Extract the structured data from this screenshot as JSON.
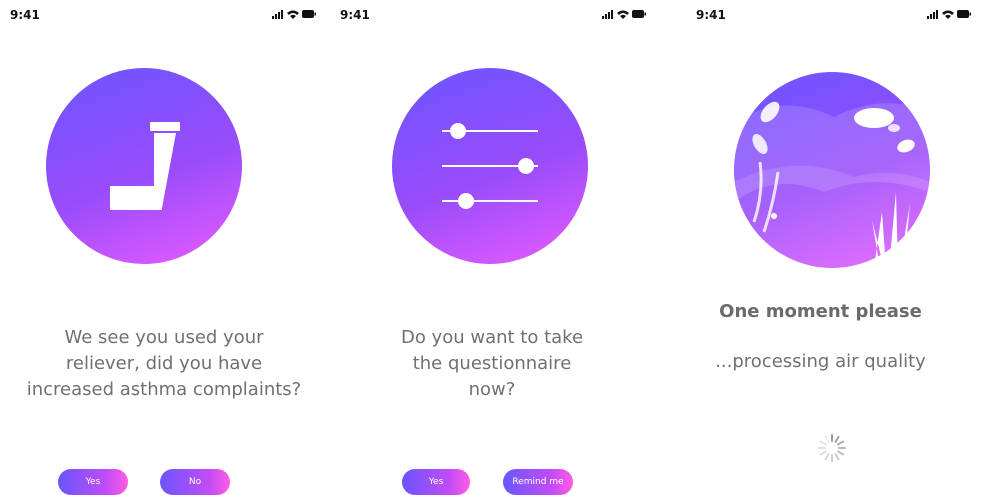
{
  "screens": [
    {
      "time": "9:41",
      "prompt": [
        "We see you used your",
        "reliever, did you have",
        "increased asthma complaints?"
      ],
      "buttons": [
        "Yes",
        "No"
      ]
    },
    {
      "time": "9:41",
      "prompt": [
        "Do you want to take",
        "the questionnaire",
        "now?"
      ],
      "buttons": [
        "Yes",
        "Remind me"
      ]
    },
    {
      "time": "9:41",
      "title": "One moment please",
      "subtitle": "...processing air quality"
    }
  ],
  "colors": {
    "gradient_start": "#6a55ff",
    "gradient_end": "#f25cff"
  },
  "icons": [
    "inhaler-icon",
    "sliders-icon",
    "nature-illustration",
    "spinner-icon"
  ]
}
